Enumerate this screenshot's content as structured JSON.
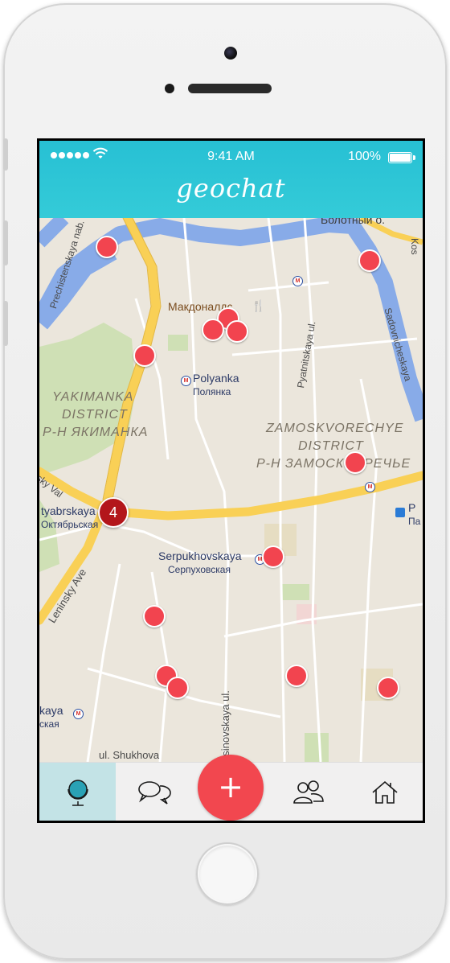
{
  "status_bar": {
    "time": "9:41 AM",
    "battery": "100%"
  },
  "app": {
    "title": "geochat"
  },
  "map": {
    "labels": {
      "bolotny": "Болотный о.",
      "prechistenskaya": "Prechistenskaya nab.",
      "mcdonalds": "Макдоналдс",
      "polyanka_en": "Polyanka",
      "polyanka_ru": "Полянка",
      "pyatnitskaya": "Pyatnitskaya ul.",
      "sadovnicheskaya": "Sadovnicheskaya",
      "kos": "Kos",
      "yakimanka_1": "YAKIMANKA",
      "yakimanka_2": "DISTRICT",
      "yakimanka_3": "Р-Н ЯКИМАНКА",
      "zamoskvorechye_1": "ZAMOSKVORECHYE",
      "zamoskvorechye_2": "DISTRICT",
      "zamoskvorechye_3": "Р-Н ЗАМОСКВОРЕЧЬЕ",
      "sky_val": "sky Val",
      "oktyabrskaya_en": "tyabrskaya",
      "oktyabrskaya_ru": "Октябрьская",
      "leninsky": "Leninsky Ave",
      "serpukhovskaya_en": "Serpukhovskaya",
      "serpukhovskaya_ru": "Серпуховская",
      "p_en": "P",
      "p_ru": "Па",
      "kaya_en": "kaya",
      "kaya_ru": "ская",
      "shukhova": "ul. Shukhova",
      "usinovskaya": "usinovskaya ul."
    },
    "cluster_count": "4"
  },
  "tabbar": {
    "items": [
      "globe-icon",
      "chat-bubbles-icon",
      "add-button",
      "people-icon",
      "home-icon"
    ],
    "add_label": "+"
  },
  "colors": {
    "header": "#2cc4d6",
    "pin": "#f2444f",
    "cluster": "#b3161b",
    "active_tab": "#c3e3e6"
  }
}
